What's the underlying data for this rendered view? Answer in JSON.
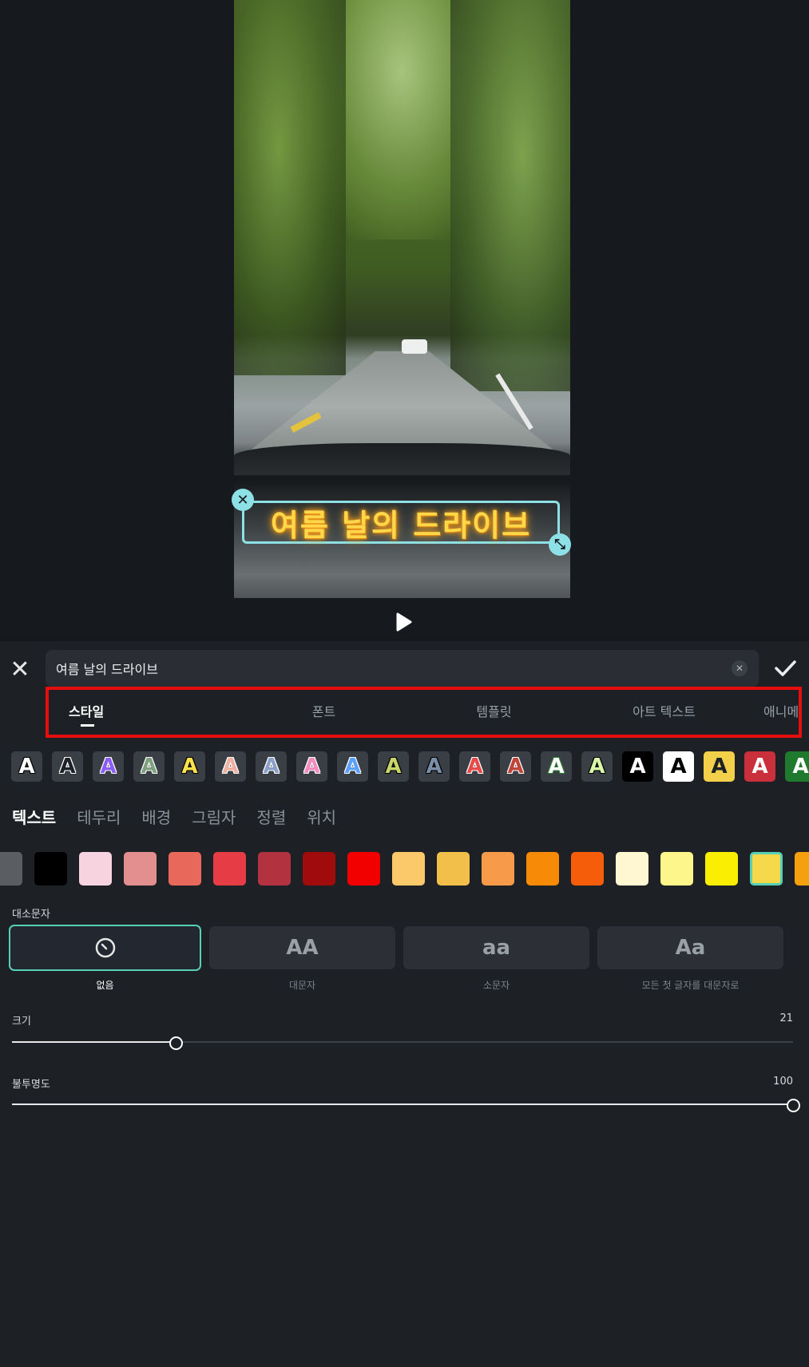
{
  "overlay_text": "여름 날의 드라이브",
  "editor": {
    "text_value": "여름 날의 드라이브"
  },
  "tabs": [
    {
      "label": "스타일",
      "active": true
    },
    {
      "label": "폰트"
    },
    {
      "label": "템플릿"
    },
    {
      "label": "아트 텍스트"
    },
    {
      "label": "애니메이션"
    }
  ],
  "style_presets": [
    {
      "glyph": "A",
      "fg": "#ffffff",
      "bg": "#3a3f45",
      "stroke": "#000000"
    },
    {
      "glyph": "A",
      "fg": "#1d2126",
      "bg": "#3a3f45",
      "stroke": "#ffffff"
    },
    {
      "glyph": "A",
      "fg": "#8b5cf6",
      "bg": "#3a3f45",
      "stroke": "#ffffff"
    },
    {
      "glyph": "A",
      "fg": "#7fa07f",
      "bg": "#3a3f45",
      "stroke": "#ffffff"
    },
    {
      "glyph": "A",
      "fg": "#ffe24a",
      "bg": "#3a3f45",
      "stroke": "#000000"
    },
    {
      "glyph": "A",
      "fg": "#f0b0a0",
      "bg": "#3a3f45",
      "stroke": "#ffffff"
    },
    {
      "glyph": "A",
      "fg": "#8aa0c8",
      "bg": "#3a3f45",
      "stroke": "#ffffff"
    },
    {
      "glyph": "A",
      "fg": "#f28cc0",
      "bg": "#3a3f45",
      "stroke": "#ffffff"
    },
    {
      "glyph": "A",
      "fg": "#5aa0ff",
      "bg": "#3a3f45",
      "stroke": "#ffffff"
    },
    {
      "glyph": "A",
      "fg": "#c8d66a",
      "bg": "#3a3f45",
      "stroke": "#000000"
    },
    {
      "glyph": "A",
      "fg": "#7a8ea8",
      "bg": "#3a3f45",
      "stroke": "#000000"
    },
    {
      "glyph": "A",
      "fg": "#e84a4a",
      "bg": "#3a3f45",
      "stroke": "#ffffff"
    },
    {
      "glyph": "A",
      "fg": "#c0443a",
      "bg": "#3a3f45",
      "stroke": "#ffffff"
    },
    {
      "glyph": "A",
      "fg": "#ffffff",
      "bg": "#3a3f45",
      "stroke": "#2e7d32"
    },
    {
      "glyph": "A",
      "fg": "#d9f7a8",
      "bg": "#3a3f45",
      "stroke": "#000000"
    },
    {
      "glyph": "A",
      "fg": "#ffffff",
      "bg": "#000000",
      "stroke": "#000000"
    },
    {
      "glyph": "A",
      "fg": "#000000",
      "bg": "#ffffff",
      "stroke": "#ffffff"
    },
    {
      "glyph": "A",
      "fg": "#1d2126",
      "bg": "#f2d04a",
      "stroke": "#f2d04a"
    },
    {
      "glyph": "A",
      "fg": "#ffffff",
      "bg": "#c9303c",
      "stroke": "#c9303c"
    },
    {
      "glyph": "A",
      "fg": "#ffffff",
      "bg": "#1f7a2e",
      "stroke": "#1f7a2e"
    }
  ],
  "subtabs": [
    {
      "label": "텍스트",
      "active": true
    },
    {
      "label": "테두리"
    },
    {
      "label": "배경"
    },
    {
      "label": "그림자"
    },
    {
      "label": "정렬"
    },
    {
      "label": "위치"
    }
  ],
  "colors": [
    {
      "hex": "#5a5d62"
    },
    {
      "hex": "#000000"
    },
    {
      "hex": "#f7d3df"
    },
    {
      "hex": "#e38f8f"
    },
    {
      "hex": "#e8695c"
    },
    {
      "hex": "#e63c45"
    },
    {
      "hex": "#b2333f"
    },
    {
      "hex": "#a00b0b"
    },
    {
      "hex": "#f20000"
    },
    {
      "hex": "#fbc86a"
    },
    {
      "hex": "#f2c04a"
    },
    {
      "hex": "#f79a4a"
    },
    {
      "hex": "#f78a06"
    },
    {
      "hex": "#f55d0b"
    },
    {
      "hex": "#fff7d2"
    },
    {
      "hex": "#fdf68a"
    },
    {
      "hex": "#faee03"
    },
    {
      "hex": "#f6d94a",
      "selected": true
    },
    {
      "hex": "#f5a00e"
    }
  ],
  "case_section": {
    "label": "대소문자",
    "options": [
      {
        "display": "⃠",
        "label": "없음",
        "selected": true
      },
      {
        "display": "AA",
        "label": "대문자"
      },
      {
        "display": "aa",
        "label": "소문자"
      },
      {
        "display": "Aa",
        "label": "모든 첫 글자를 대문자로"
      }
    ]
  },
  "size": {
    "label": "크기",
    "value": 21,
    "value_text": "21",
    "fraction": 0.21
  },
  "opacity": {
    "label": "불투명도",
    "value": 100,
    "value_text": "100",
    "fraction": 1.0
  },
  "icons": {
    "play": "play-icon",
    "close": "close-icon",
    "confirm": "check-icon",
    "clear": "clear-icon",
    "remove_overlay": "close-icon",
    "resize": "resize-icon",
    "none_case": "no-case-icon"
  },
  "accent_color": "#57d1b5",
  "highlight_color": "#e60d0d"
}
